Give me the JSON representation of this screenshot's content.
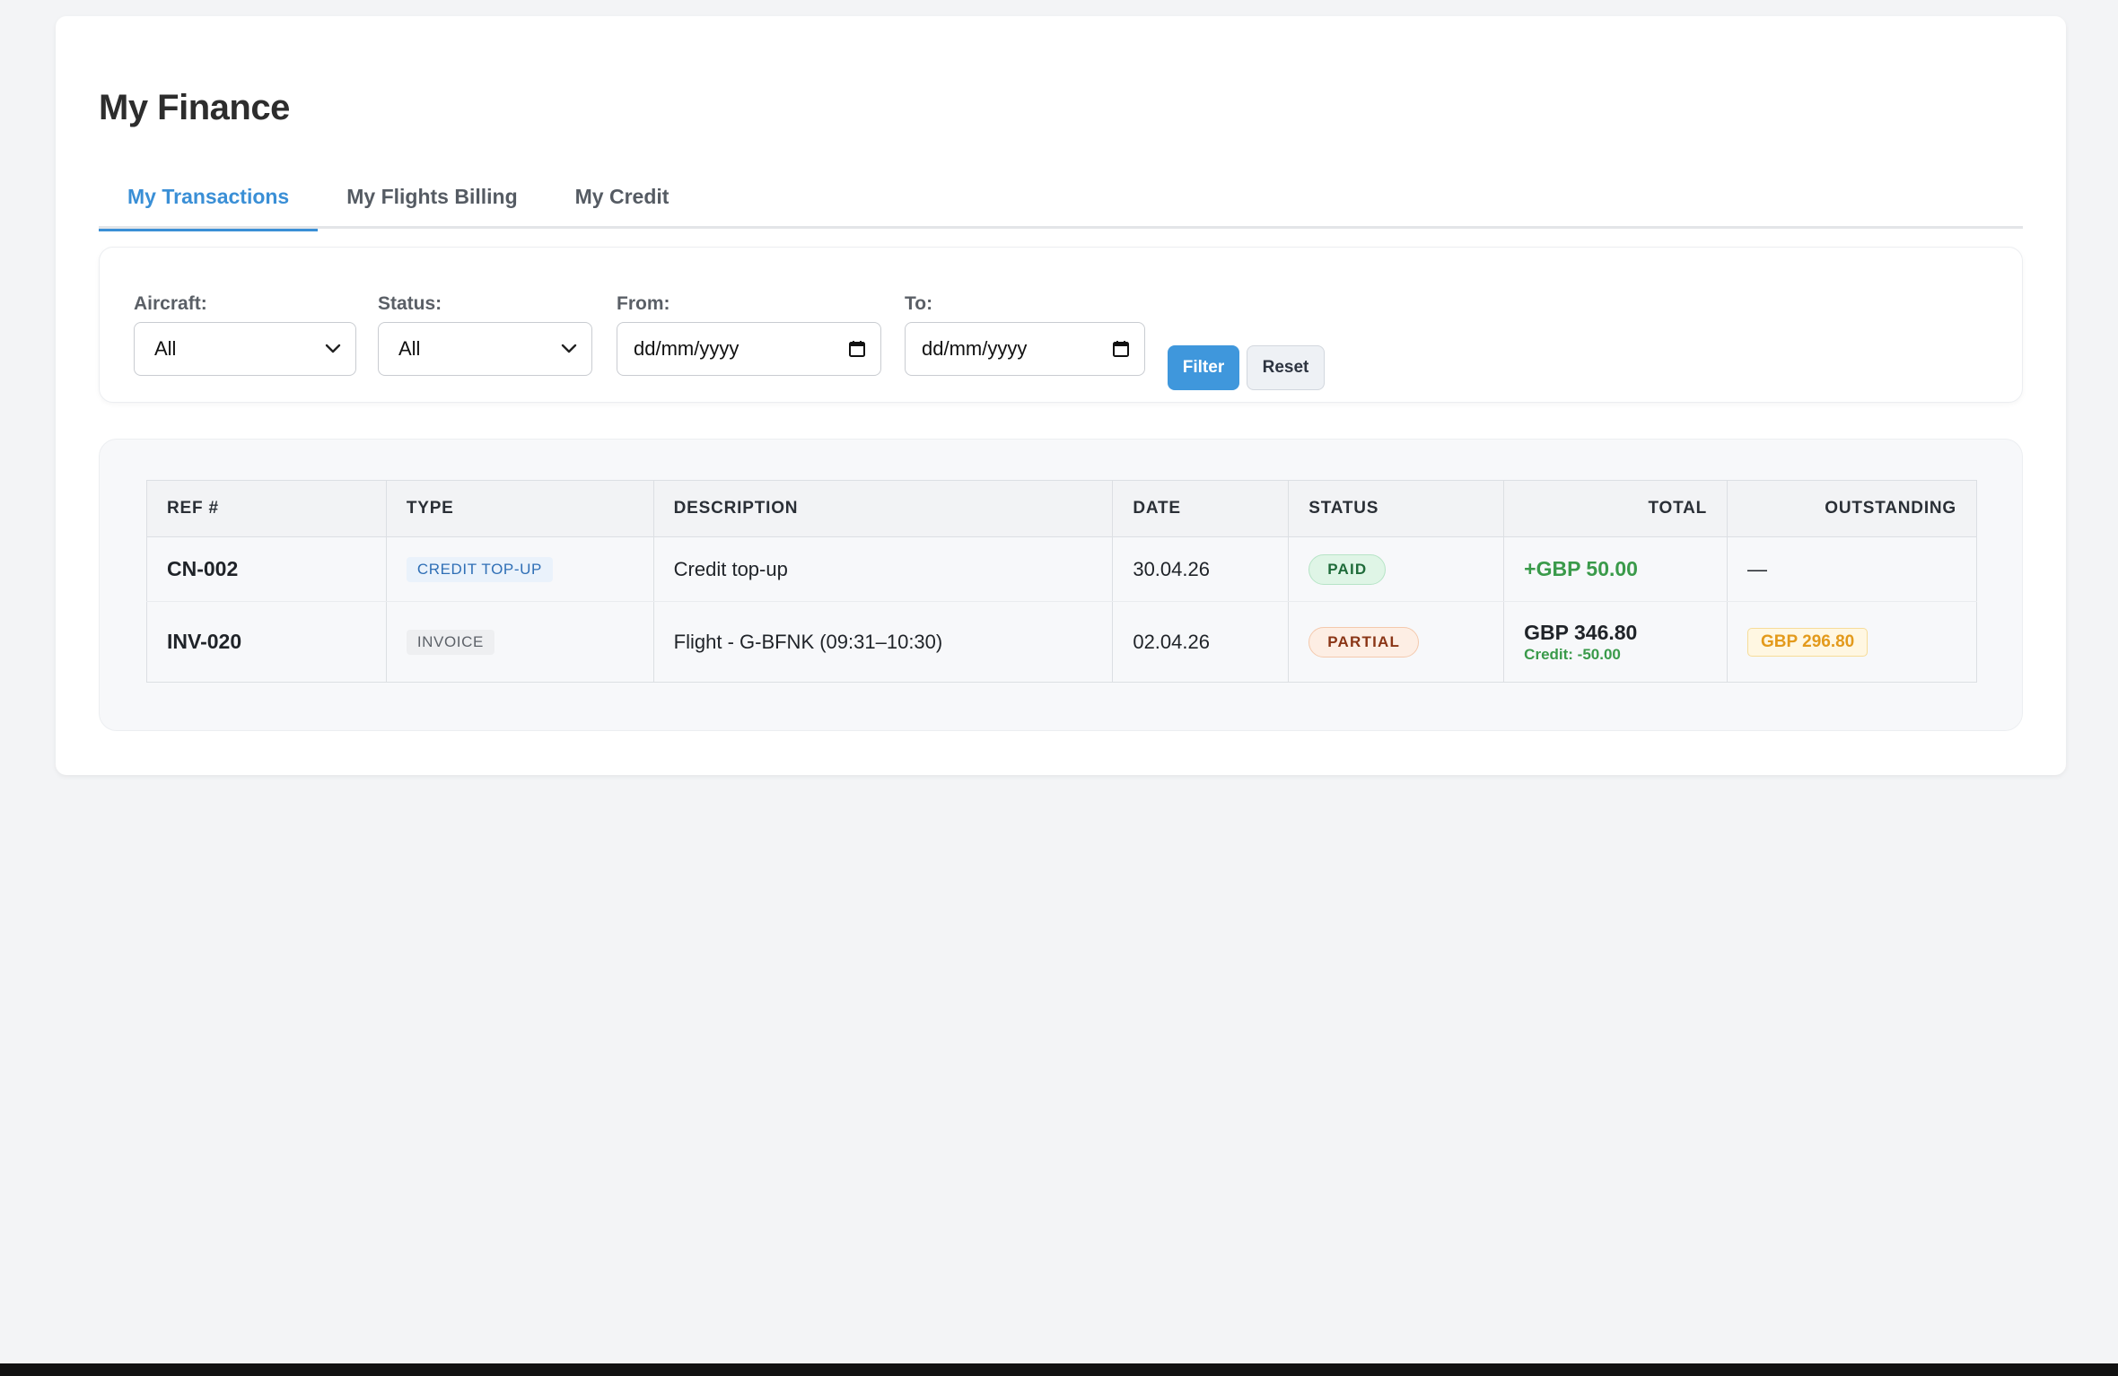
{
  "page": {
    "title": "My Finance"
  },
  "tabs": [
    {
      "label": "My Transactions",
      "active": true
    },
    {
      "label": "My Flights Billing",
      "active": false
    },
    {
      "label": "My Credit",
      "active": false
    }
  ],
  "filters": {
    "aircraft": {
      "label": "Aircraft:",
      "value": "All"
    },
    "status": {
      "label": "Status:",
      "value": "All"
    },
    "from": {
      "label": "From:",
      "value": "dd/mm/yyyy"
    },
    "to": {
      "label": "To:",
      "value": "dd/mm/yyyy"
    },
    "filter_button": "Filter",
    "reset_button": "Reset"
  },
  "table": {
    "columns": [
      "REF #",
      "TYPE",
      "DESCRIPTION",
      "DATE",
      "STATUS",
      "TOTAL",
      "OUTSTANDING"
    ],
    "rows": [
      {
        "ref": "CN-002",
        "type": "CREDIT TOP-UP",
        "description": "Credit top-up",
        "date": "30.04.26",
        "status": "PAID",
        "total": "+GBP 50.00",
        "outstanding": "—"
      },
      {
        "ref": "INV-020",
        "type": "INVOICE",
        "description": "Flight - G-BFNK (09:31–10:30)",
        "date": "02.04.26",
        "status": "PARTIAL",
        "total": "GBP 346.80",
        "total_note": "Credit: -50.00",
        "outstanding": "GBP 296.80"
      }
    ]
  },
  "colors": {
    "accent": "#3a8fd6",
    "positive": "#3a9a4a",
    "outstanding": "#e39a1c",
    "background": "#f3f4f6"
  },
  "icons": {
    "select_arrow": "chevron-down-icon",
    "date_picker": "calendar-icon"
  }
}
